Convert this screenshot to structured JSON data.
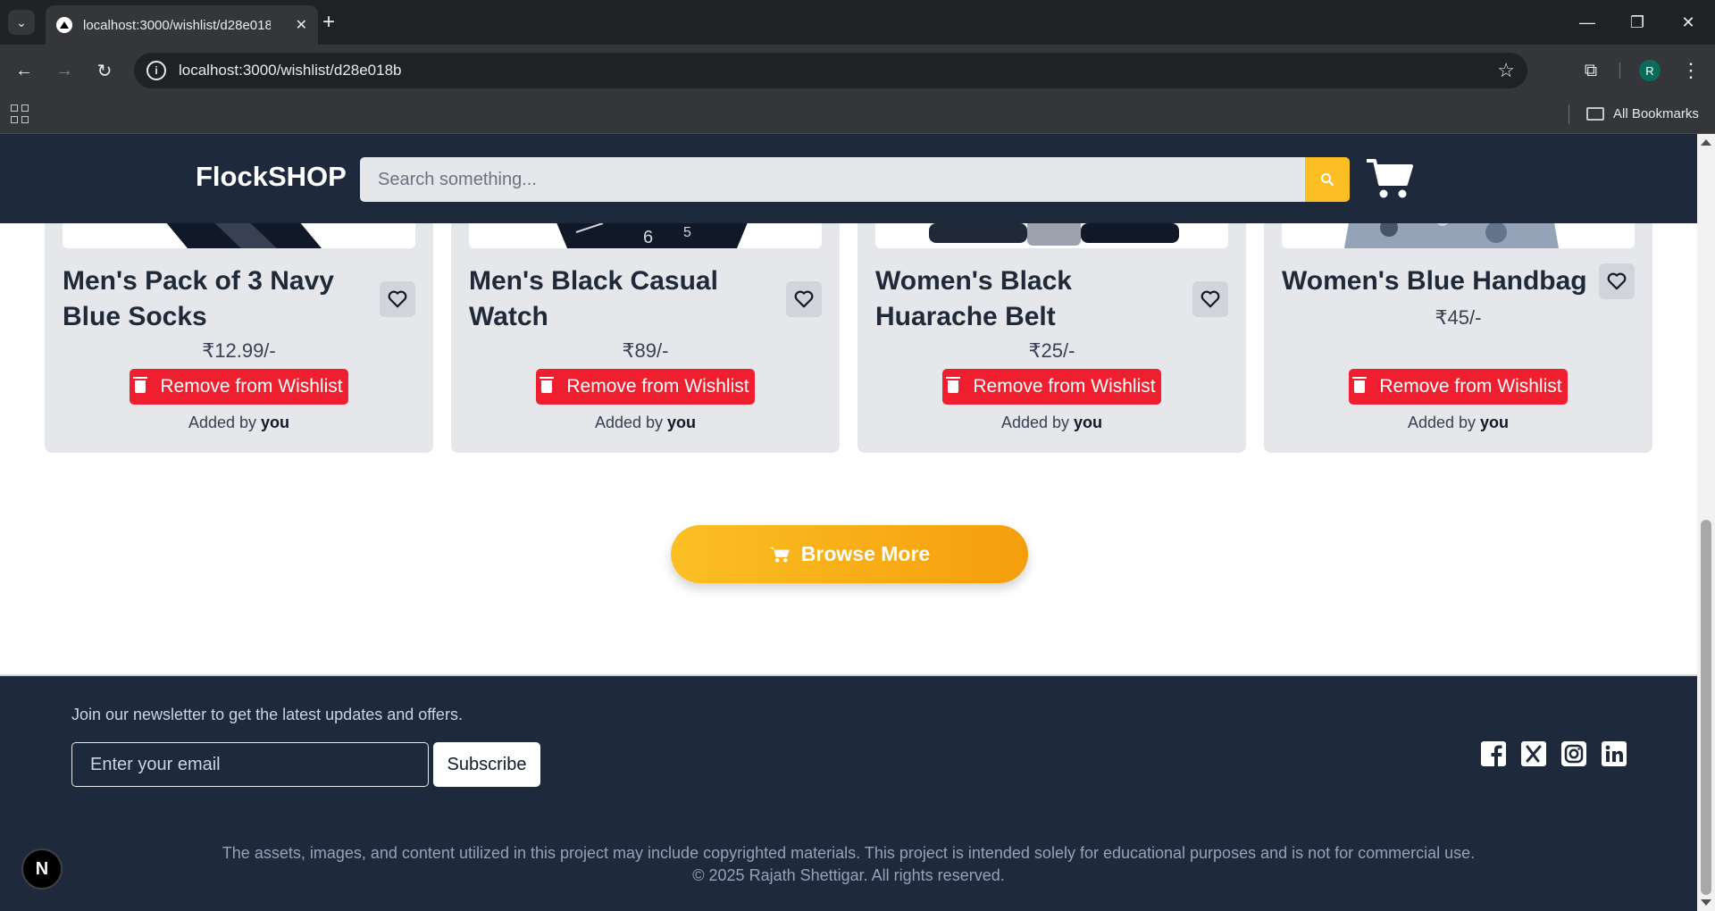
{
  "browser": {
    "tab_title": "localhost:3000/wishlist/d28e018b",
    "url": "localhost:3000/wishlist/d28e018b",
    "profile_initial": "R",
    "all_bookmarks_label": "All Bookmarks"
  },
  "header": {
    "brand": "FlockSHOP",
    "search_placeholder": "Search something..."
  },
  "products": [
    {
      "title": "Men's Pack of 3 Navy Blue Socks",
      "price": "₹12.99/-",
      "remove_label": "Remove from Wishlist",
      "added_by_prefix": "Added by",
      "added_by": "you"
    },
    {
      "title": "Men's Black Casual Watch",
      "price": "₹89/-",
      "remove_label": "Remove from Wishlist",
      "added_by_prefix": "Added by",
      "added_by": "you"
    },
    {
      "title": "Women's Black Huarache Belt",
      "price": "₹25/-",
      "remove_label": "Remove from Wishlist",
      "added_by_prefix": "Added by",
      "added_by": "you"
    },
    {
      "title": "Women's Blue Handbag",
      "price": "₹45/-",
      "remove_label": "Remove from Wishlist",
      "added_by_prefix": "Added by",
      "added_by": "you"
    }
  ],
  "browse_more_label": "Browse More",
  "footer": {
    "newsletter_text": "Join our newsletter to get the latest updates and offers.",
    "email_placeholder": "Enter your email",
    "subscribe_label": "Subscribe",
    "disclaimer": "The assets, images, and content utilized in this project may include copyrighted materials. This project is intended solely for educational purposes and is not for commercial use.",
    "copyright": "© 2025 Rajath Shettigar. All rights reserved."
  },
  "dev_badge": "N",
  "colors": {
    "header_bg": "#1e293b",
    "accent": "#fbbf24",
    "remove_button": "#ef1f2f",
    "card_bg": "#e5e7eb"
  },
  "icons": {
    "search": "search-icon",
    "cart": "cart-icon",
    "heart": "heart-icon",
    "trash": "trash-icon",
    "social": [
      "facebook-icon",
      "x-icon",
      "instagram-icon",
      "linkedin-icon"
    ]
  }
}
